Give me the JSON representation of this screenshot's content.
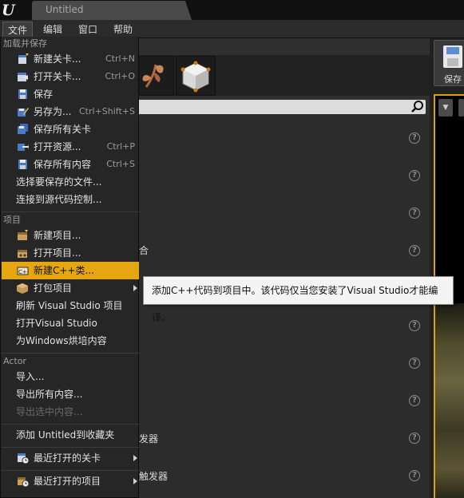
{
  "window": {
    "tab_title": "Untitled"
  },
  "menubar": {
    "items": [
      {
        "label": "文件",
        "active": true
      },
      {
        "label": "编辑",
        "active": false
      },
      {
        "label": "窗口",
        "active": false
      },
      {
        "label": "帮助",
        "active": false
      }
    ]
  },
  "file_menu": {
    "sections": {
      "load_save": "加载并保存",
      "project": "项目",
      "actor": "Actor"
    },
    "items": {
      "new_level": {
        "label": "新建关卡...",
        "shortcut": "Ctrl+N",
        "icon": "new-level-icon"
      },
      "open_level": {
        "label": "打开关卡...",
        "shortcut": "Ctrl+O",
        "icon": "open-level-icon"
      },
      "save": {
        "label": "保存",
        "icon": "save-icon"
      },
      "save_as": {
        "label": "另存为...",
        "shortcut": "Ctrl+Shift+S",
        "icon": "save-as-icon"
      },
      "save_all_levels": {
        "label": "保存所有关卡",
        "icon": "save-all-levels-icon"
      },
      "open_asset": {
        "label": "打开资源...",
        "shortcut": "Ctrl+P",
        "icon": "open-asset-icon"
      },
      "save_all": {
        "label": "保存所有内容",
        "shortcut": "Ctrl+S",
        "icon": "save-all-icon"
      },
      "choose_files_to_save": {
        "label": "选择要保存的文件..."
      },
      "connect_source_control": {
        "label": "连接到源代码控制..."
      },
      "new_project": {
        "label": "新建项目...",
        "icon": "new-project-icon"
      },
      "open_project": {
        "label": "打开项目...",
        "icon": "open-project-icon"
      },
      "new_cpp_class": {
        "label": "新建C++类...",
        "icon": "cpp-class-icon",
        "highlighted": true
      },
      "package_project": {
        "label": "打包项目",
        "icon": "package-icon"
      },
      "refresh_vs_project": {
        "label": "刷新 Visual Studio 项目"
      },
      "open_vs": {
        "label": "打开Visual Studio"
      },
      "cook_windows": {
        "label": "为Windows烘培内容"
      },
      "import": {
        "label": "导入..."
      },
      "export_all": {
        "label": "导出所有内容..."
      },
      "export_selected": {
        "label": "导出选中内容...",
        "disabled": true
      },
      "add_favorites": {
        "label": "添加 Untitled到收藏夹"
      },
      "recent_levels": {
        "label": "最近打开的关卡",
        "icon": "recent-levels-icon"
      },
      "recent_projects": {
        "label": "最近打开的项目",
        "icon": "recent-projects-icon"
      }
    }
  },
  "tooltip": {
    "text": "添加C++代码到项目中。该代码仅当您安装了Visual Studio才能编译。"
  },
  "background": {
    "clipped_labels": [
      "合",
      "发器",
      "触发器"
    ],
    "save_button_label": "保存"
  },
  "colors": {
    "highlight": "#e6a60f",
    "viewport_border": "#d6a400",
    "menu_bg": "#262626"
  }
}
